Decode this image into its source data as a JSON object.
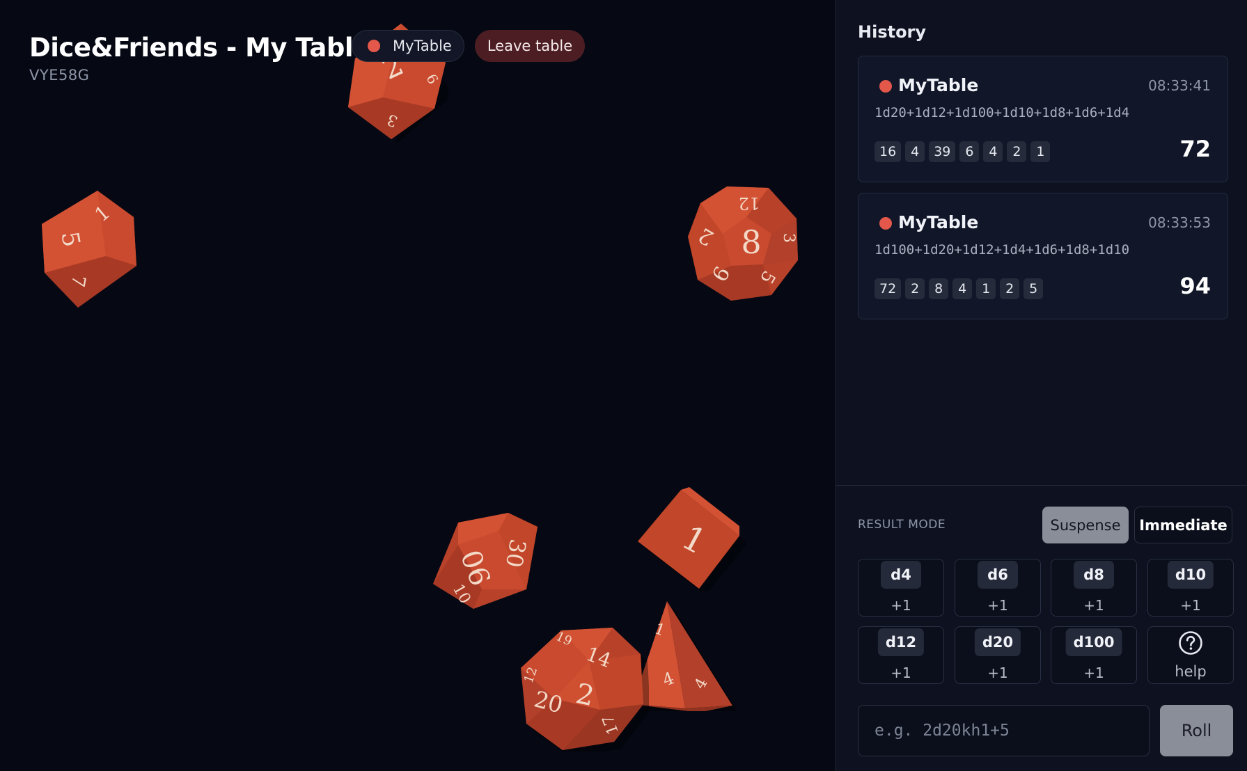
{
  "header": {
    "title": "Dice&Friends - My Table",
    "code": "VYE58G",
    "table_pill": "MyTable",
    "leave_button": "Leave table"
  },
  "colors": {
    "background": "#060914",
    "sidebar": "#0d1120",
    "die": "#c94a2e",
    "player_dot": "#e3584a",
    "leave": "#4c1e23"
  },
  "dice_on_table": [
    {
      "type": "d8",
      "faces": [
        "2",
        "3",
        "6"
      ]
    },
    {
      "type": "d10",
      "faces": [
        "1",
        "5",
        "7"
      ]
    },
    {
      "type": "d12",
      "faces": [
        "8",
        "12",
        "2",
        "6",
        "5",
        "3"
      ]
    },
    {
      "type": "d100",
      "faces": [
        "90",
        "30",
        "10"
      ]
    },
    {
      "type": "d6",
      "faces": [
        "1"
      ]
    },
    {
      "type": "d20",
      "faces": [
        "2",
        "14",
        "20",
        "19",
        "17",
        "12"
      ]
    },
    {
      "type": "d4",
      "faces": [
        "1",
        "4",
        "4"
      ]
    }
  ],
  "history": {
    "heading": "History",
    "entries": [
      {
        "table": "MyTable",
        "time": "08:33:41",
        "expression": "1d20+1d12+1d100+1d10+1d8+1d6+1d4",
        "rolls": [
          "16",
          "4",
          "39",
          "6",
          "4",
          "2",
          "1"
        ],
        "total": "72"
      },
      {
        "table": "MyTable",
        "time": "08:33:53",
        "expression": "1d100+1d20+1d12+1d4+1d6+1d8+1d10",
        "rolls": [
          "72",
          "2",
          "8",
          "4",
          "1",
          "2",
          "5"
        ],
        "total": "94"
      }
    ]
  },
  "controls": {
    "result_mode_label": "RESULT MODE",
    "mode_options": [
      "Suspense",
      "Immediate"
    ],
    "selected_mode": "Suspense",
    "dice_buttons": [
      {
        "label": "d4",
        "increment": "+1"
      },
      {
        "label": "d6",
        "increment": "+1"
      },
      {
        "label": "d8",
        "increment": "+1"
      },
      {
        "label": "d10",
        "increment": "+1"
      },
      {
        "label": "d12",
        "increment": "+1"
      },
      {
        "label": "d20",
        "increment": "+1"
      },
      {
        "label": "d100",
        "increment": "+1"
      }
    ],
    "help_label": "help",
    "help_icon": "question-circle-icon",
    "input_placeholder": "e.g. 2d20kh1+5",
    "input_value": "",
    "roll_button": "Roll"
  }
}
